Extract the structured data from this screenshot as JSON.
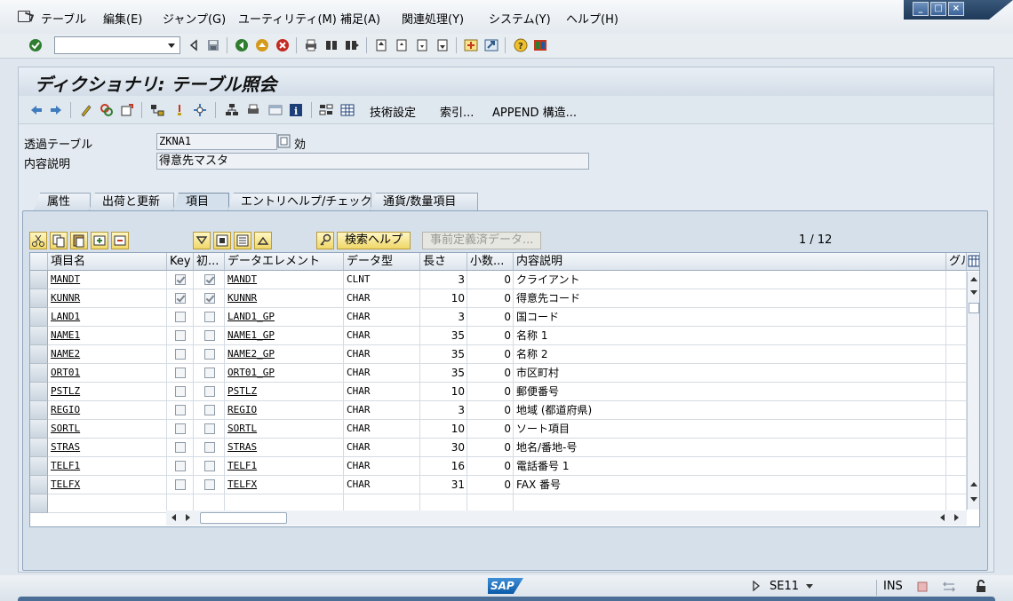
{
  "menu": {
    "items": [
      "テーブル",
      "編集(E)",
      "ジャンプ(G)",
      "ユーティリティ(M)",
      "補足(A)",
      "関連処理(Y)",
      "システム(Y)",
      "ヘルプ(H)"
    ]
  },
  "std_toolbar": {
    "command_value": "",
    "icons": [
      "enter-icon",
      "save-icon",
      "back-icon",
      "exit-icon",
      "cancel-icon",
      "print-icon",
      "find-icon",
      "find-next-icon",
      "first-page-icon",
      "prev-page-icon",
      "next-page-icon",
      "last-page-icon",
      "create-session-icon",
      "shortcut-icon",
      "help-icon",
      "layout-icon"
    ]
  },
  "page": {
    "title": "ディクショナリ: テーブル照会"
  },
  "app_toolbar": {
    "tech_settings": "技術設定",
    "index": "索引...",
    "append": "APPEND 構造..."
  },
  "header": {
    "table_label": "透過テーブル",
    "table_value": "ZKNA1",
    "status": "効",
    "desc_label": "内容説明",
    "desc_value": "得意先マスタ"
  },
  "tabs": [
    {
      "label": "属性",
      "active": false
    },
    {
      "label": "出荷と更新",
      "active": false
    },
    {
      "label": "項目",
      "active": true
    },
    {
      "label": "エントリヘルプ/チェック",
      "active": false
    },
    {
      "label": "通貨/数量項目",
      "active": false
    }
  ],
  "grid_toolbar": {
    "search_help": "検索ヘルプ",
    "predefined": "事前定義済データ...",
    "page_info": "1 / 12"
  },
  "table": {
    "columns": [
      "項目名",
      "Key",
      "初...",
      "データエレメント",
      "データ型",
      "長さ",
      "小数...",
      "内容説明",
      "グル"
    ],
    "rows": [
      {
        "field": "MANDT",
        "key": true,
        "init": true,
        "element": "MANDT",
        "type": "CLNT",
        "length": "3",
        "decimals": "0",
        "desc": "クライアント"
      },
      {
        "field": "KUNNR",
        "key": true,
        "init": true,
        "element": "KUNNR",
        "type": "CHAR",
        "length": "10",
        "decimals": "0",
        "desc": "得意先コード"
      },
      {
        "field": "LAND1",
        "key": false,
        "init": false,
        "element": "LAND1_GP",
        "type": "CHAR",
        "length": "3",
        "decimals": "0",
        "desc": "国コード"
      },
      {
        "field": "NAME1",
        "key": false,
        "init": false,
        "element": "NAME1_GP",
        "type": "CHAR",
        "length": "35",
        "decimals": "0",
        "desc": "名称 1"
      },
      {
        "field": "NAME2",
        "key": false,
        "init": false,
        "element": "NAME2_GP",
        "type": "CHAR",
        "length": "35",
        "decimals": "0",
        "desc": "名称 2"
      },
      {
        "field": "ORT01",
        "key": false,
        "init": false,
        "element": "ORT01_GP",
        "type": "CHAR",
        "length": "35",
        "decimals": "0",
        "desc": "市区町村"
      },
      {
        "field": "PSTLZ",
        "key": false,
        "init": false,
        "element": "PSTLZ",
        "type": "CHAR",
        "length": "10",
        "decimals": "0",
        "desc": "郵便番号"
      },
      {
        "field": "REGIO",
        "key": false,
        "init": false,
        "element": "REGIO",
        "type": "CHAR",
        "length": "3",
        "decimals": "0",
        "desc": "地域 (都道府県)"
      },
      {
        "field": "SORTL",
        "key": false,
        "init": false,
        "element": "SORTL",
        "type": "CHAR",
        "length": "10",
        "decimals": "0",
        "desc": "ソート項目"
      },
      {
        "field": "STRAS",
        "key": false,
        "init": false,
        "element": "STRAS",
        "type": "CHAR",
        "length": "30",
        "decimals": "0",
        "desc": "地名/番地-号"
      },
      {
        "field": "TELF1",
        "key": false,
        "init": false,
        "element": "TELF1",
        "type": "CHAR",
        "length": "16",
        "decimals": "0",
        "desc": "電話番号 1"
      },
      {
        "field": "TELFX",
        "key": false,
        "init": false,
        "element": "TELFX",
        "type": "CHAR",
        "length": "31",
        "decimals": "0",
        "desc": "FAX 番号"
      }
    ]
  },
  "status_bar": {
    "transaction": "SE11",
    "mode": "INS"
  }
}
